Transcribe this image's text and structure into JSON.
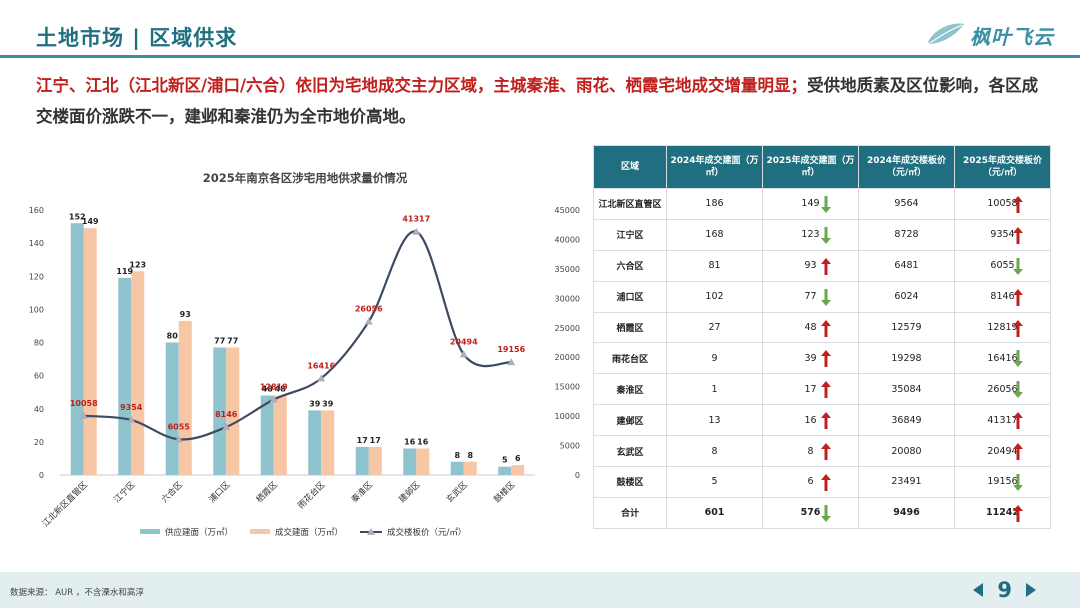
{
  "header": {
    "title": "土地市场 | 区域供求",
    "logo_text": "枫叶飞云"
  },
  "summary": {
    "part_highlight": "江宁、江北（江北新区/浦口/六合）依旧为宅地成交主力区域，主城秦淮、雨花、栖霞宅地成交增量明显；",
    "part_normal": "受供地质素及区位影响，各区成交楼面价涨跌不一，建邺和秦淮仍为全市地价高地。"
  },
  "chart_data": {
    "type": "bar",
    "title": "2025年南京各区涉宅用地供求量价情况",
    "categories": [
      "江北新区直管区",
      "江宁区",
      "六合区",
      "浦口区",
      "栖霞区",
      "雨花台区",
      "秦淮区",
      "建邺区",
      "玄武区",
      "鼓楼区"
    ],
    "series": [
      {
        "name": "供应建面（万㎡）",
        "type": "bar",
        "axis": "left",
        "color": "#8fc3cd",
        "values": [
          152,
          119,
          80,
          77,
          48,
          39,
          17,
          16,
          8,
          5
        ]
      },
      {
        "name": "成交建面（万㎡）",
        "type": "bar",
        "axis": "left",
        "color": "#f7c6a4",
        "values": [
          149,
          123,
          93,
          77,
          48,
          39,
          17,
          16,
          8,
          6
        ]
      },
      {
        "name": "成交楼板价（元/㎡）",
        "type": "line",
        "axis": "right",
        "color": "#3c4a63",
        "values": [
          10058,
          9354,
          6055,
          8146,
          12819,
          16416,
          26056,
          41317,
          20494,
          19156
        ]
      }
    ],
    "ylim_left": [
      0,
      160
    ],
    "yticks_left": [
      0,
      20,
      40,
      60,
      80,
      100,
      120,
      140,
      160
    ],
    "ylim_right": [
      0,
      45000
    ],
    "yticks_right": [
      0,
      5000,
      10000,
      15000,
      20000,
      25000,
      30000,
      35000,
      40000,
      45000
    ],
    "grid": false,
    "legend_position": "bottom"
  },
  "table": {
    "headers": [
      "区域",
      "2024年成交建面（万㎡）",
      "2025年成交建面（万㎡）",
      "2024年成交楼板价（元/㎡）",
      "2025年成交楼板价（元/㎡）"
    ],
    "rows": [
      {
        "region": "江北新区直管区",
        "area2024": "186",
        "area2025": "149",
        "areaTrend": "down",
        "price2024": "9564",
        "price2025": "10058",
        "priceTrend": "up"
      },
      {
        "region": "江宁区",
        "area2024": "168",
        "area2025": "123",
        "areaTrend": "down",
        "price2024": "8728",
        "price2025": "9354",
        "priceTrend": "up"
      },
      {
        "region": "六合区",
        "area2024": "81",
        "area2025": "93",
        "areaTrend": "up",
        "price2024": "6481",
        "price2025": "6055",
        "priceTrend": "down"
      },
      {
        "region": "浦口区",
        "area2024": "102",
        "area2025": "77",
        "areaTrend": "down",
        "price2024": "6024",
        "price2025": "8146",
        "priceTrend": "up"
      },
      {
        "region": "栖霞区",
        "area2024": "27",
        "area2025": "48",
        "areaTrend": "up",
        "price2024": "12579",
        "price2025": "12819",
        "priceTrend": "up"
      },
      {
        "region": "雨花台区",
        "area2024": "9",
        "area2025": "39",
        "areaTrend": "up",
        "price2024": "19298",
        "price2025": "16416",
        "priceTrend": "down"
      },
      {
        "region": "秦淮区",
        "area2024": "1",
        "area2025": "17",
        "areaTrend": "up",
        "price2024": "35084",
        "price2025": "26056",
        "priceTrend": "down"
      },
      {
        "region": "建邺区",
        "area2024": "13",
        "area2025": "16",
        "areaTrend": "up",
        "price2024": "36849",
        "price2025": "41317",
        "priceTrend": "up"
      },
      {
        "region": "玄武区",
        "area2024": "8",
        "area2025": "8",
        "areaTrend": "up",
        "price2024": "20080",
        "price2025": "20494",
        "priceTrend": "up"
      },
      {
        "region": "鼓楼区",
        "area2024": "5",
        "area2025": "6",
        "areaTrend": "up",
        "price2024": "23491",
        "price2025": "19156",
        "priceTrend": "down"
      },
      {
        "region": "合计",
        "area2024": "601",
        "area2025": "576",
        "areaTrend": "down",
        "price2024": "9496",
        "price2025": "11242",
        "priceTrend": "up"
      }
    ],
    "colors": {
      "up": "#c0201d",
      "down": "#6aa84f"
    }
  },
  "footer": {
    "source": "数据来源： AUR ，不含溧水和高淳",
    "page": "9"
  }
}
